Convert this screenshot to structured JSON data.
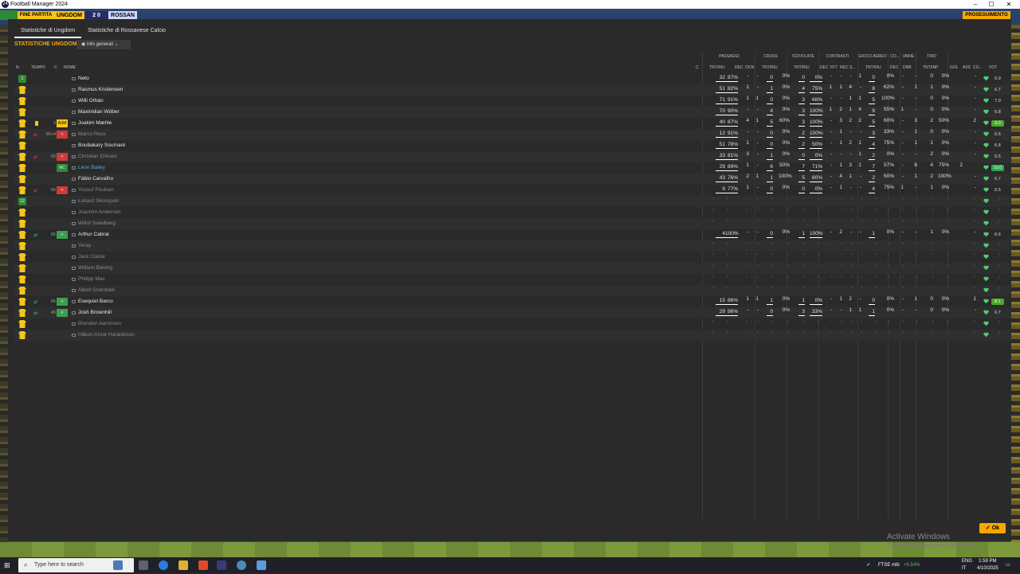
{
  "window": {
    "title": "Football Manager 2024",
    "app_icon": "24",
    "minimize": "–",
    "maximize": "☐",
    "close": "✕"
  },
  "scorebar": {
    "end_label": "FINE PARTITA",
    "home": "UNGDOM",
    "score": "2  0",
    "away": "ROSSAN",
    "continue": "PROSEGUIMENTO"
  },
  "tabs": [
    {
      "label": "Statistiche di Ungdom",
      "active": true
    },
    {
      "label": "Statistiche di Rossanese Calcio",
      "active": false
    }
  ],
  "section_title": "STATISTICHE UNGDOM",
  "view_select": {
    "label": "Info generali"
  },
  "groups": {
    "passaggi": "PASSAGGI",
    "cross": "CROSS",
    "scivolate": "SCIVOLATE",
    "contrasti": "CONTRASTI",
    "gioco_aereo": "GIOCO AEREO",
    "co": "CO...",
    "varie": "VARIE",
    "tiro": "TIRO"
  },
  "columns": {
    "n": "N.",
    "tempo": "TEMPO",
    "c": "C",
    "nome": "NOME",
    "c2": "C",
    "tnt_riu": "TNT/RIU",
    "dec": "DEC",
    "occ": "OCN",
    "cross_tnt": "TNT/RIU",
    "sciv_tnt": "TNT/RIU",
    "contr_dec": "DEC",
    "fft": "FFT",
    "rec": "REC S...",
    "aereo_tnt": "TNT/RIU",
    "co_dec": "DEC",
    "drb": "DRB",
    "tiro_tnt": "TNT/INP",
    "gol": "GOL",
    "ass": "ASS",
    "co2": "CO...",
    "vot": "VOT"
  },
  "players": [
    {
      "name": "Neto",
      "num": "1",
      "kit": "gk",
      "pass_t": "32",
      "pass_p": "87%",
      "dec": "-",
      "occ": "-",
      "cross_t": "0",
      "cross_p": "0%",
      "sciv_t": "0",
      "sciv_p": "0%",
      "c_dec": "-",
      "fft": "-",
      "rec": "-",
      "s": "1",
      "aer_t": "0",
      "aer_p": "0%",
      "co_dec": "-",
      "drb": "-",
      "tiro_t": "0",
      "tiro_p": "0%",
      "gol": "",
      "ass": "-",
      "rating": "6.9"
    },
    {
      "name": "Rasmus Kristensen",
      "pass_t": "51",
      "pass_p": "82%",
      "dec": "1",
      "occ": "-",
      "cross_t": "1",
      "cross_p": "0%",
      "sciv_t": "4",
      "sciv_p": "75%",
      "c_dec": "1",
      "fft": "1",
      "rec": "4",
      "s": "-",
      "aer_t": "8",
      "aer_p": "62%",
      "co_dec": "-",
      "drb": "1",
      "tiro_t": "1",
      "tiro_p": "0%",
      "gol": "",
      "ass": "-",
      "rating": "6.7"
    },
    {
      "name": "Willi Orbán",
      "pass_t": "71",
      "pass_p": "91%",
      "dec": "1",
      "occ": "1",
      "cross_t": "0",
      "cross_p": "0%",
      "sciv_t": "3",
      "sciv_p": "66%",
      "c_dec": "-",
      "fft": "-",
      "rec": "1",
      "s": "1",
      "aer_t": "5",
      "aer_p": "100%",
      "co_dec": "-",
      "drb": "-",
      "tiro_t": "0",
      "tiro_p": "0%",
      "gol": "",
      "ass": "-",
      "rating": "7.0"
    },
    {
      "name": "Maximilian Wöber",
      "pass_t": "70",
      "pass_p": "90%",
      "dec": "-",
      "occ": "-",
      "cross_t": "4",
      "cross_p": "0%",
      "sciv_t": "3",
      "sciv_p": "100%",
      "c_dec": "1",
      "fft": "2",
      "rec": "1",
      "s": "4",
      "aer_t": "9",
      "aer_p": "55%",
      "co_dec": "1",
      "drb": "-",
      "tiro_t": "0",
      "tiro_p": "0%",
      "gol": "",
      "ass": "-",
      "rating": "6.8"
    },
    {
      "name": "Joakim Mæhle",
      "time": "3",
      "pos": "ASM",
      "pos_color": "yellow",
      "card": true,
      "pass_t": "40",
      "pass_p": "87%",
      "dec": "4",
      "occ": "1",
      "cross_t": "5",
      "cross_p": "60%",
      "sciv_t": "3",
      "sciv_p": "100%",
      "c_dec": "-",
      "fft": "3",
      "rec": "2",
      "s": "2",
      "aer_t": "5",
      "aer_p": "60%",
      "co_dec": "-",
      "drb": "3",
      "tiro_t": "2",
      "tiro_p": "50%",
      "gol": "",
      "ass": "2",
      "rating": "9.0",
      "rating_style": "high"
    },
    {
      "name": "Marco Reus",
      "time": "90+4",
      "pos": "<",
      "pos_color": "red",
      "sub": "out",
      "dim": true,
      "pass_t": "12",
      "pass_p": "91%",
      "dec": "-",
      "occ": "-",
      "cross_t": "0",
      "cross_p": "0%",
      "sciv_t": "2",
      "sciv_p": "100%",
      "c_dec": "-",
      "fft": "1",
      "rec": "-",
      "s": "-",
      "aer_t": "3",
      "aer_p": "33%",
      "co_dec": "-",
      "drb": "1",
      "tiro_t": "0",
      "tiro_p": "0%",
      "gol": "",
      "ass": "-",
      "rating": "6.6"
    },
    {
      "name": "Boubakary Soumaré",
      "pass_t": "51",
      "pass_p": "78%",
      "dec": "1",
      "occ": "-",
      "cross_t": "0",
      "cross_p": "0%",
      "sciv_t": "2",
      "sciv_p": "50%",
      "c_dec": "-",
      "fft": "1",
      "rec": "2",
      "s": "1",
      "aer_t": "4",
      "aer_p": "75%",
      "co_dec": "-",
      "drb": "1",
      "tiro_t": "1",
      "tiro_p": "0%",
      "gol": "",
      "ass": "-",
      "rating": "6.8"
    },
    {
      "name": "Christian Eriksen",
      "time": "65",
      "pos": "<",
      "pos_color": "red",
      "sub": "out",
      "dim": true,
      "pass_t": "33",
      "pass_p": "81%",
      "dec": "3",
      "occ": "-",
      "cross_t": "1",
      "cross_p": "0%",
      "sciv_t": "0",
      "sciv_p": "0%",
      "c_dec": "-",
      "fft": "-",
      "rec": "-",
      "s": "1",
      "aer_t": "2",
      "aer_p": "0%",
      "co_dec": "-",
      "drb": "-",
      "tiro_t": "2",
      "tiro_p": "0%",
      "gol": "",
      "ass": "-",
      "rating": "6.5"
    },
    {
      "name": "Leon Bailey",
      "pos": "MC",
      "pos_color": "mc",
      "hl": true,
      "pass_t": "29",
      "pass_p": "89%",
      "dec": "1",
      "occ": "-",
      "cross_t": "6",
      "cross_p": "50%",
      "sciv_t": "7",
      "sciv_p": "71%",
      "c_dec": "-",
      "fft": "1",
      "rec": "3",
      "s": "1",
      "aer_t": "7",
      "aer_p": "57%",
      "co_dec": "-",
      "drb": "6",
      "tiro_t": "4",
      "tiro_p": "75%",
      "gol": "2",
      "ass": "",
      "rating": "10.0",
      "rating_style": "top"
    },
    {
      "name": "Fábio Carvalho",
      "pass_t": "43",
      "pass_p": "76%",
      "dec": "2",
      "occ": "1",
      "cross_t": "1",
      "cross_p": "100%",
      "sciv_t": "5",
      "sciv_p": "80%",
      "c_dec": "-",
      "fft": "4",
      "rec": "1",
      "s": "-",
      "aer_t": "2",
      "aer_p": "50%",
      "co_dec": "-",
      "drb": "1",
      "tiro_t": "2",
      "tiro_p": "100%",
      "gol": "",
      "ass": "-",
      "rating": "6.7"
    },
    {
      "name": "Yussuf Poulsen",
      "time": "65",
      "pos": "<",
      "pos_color": "red",
      "sub": "out",
      "dim": true,
      "pass_t": "9",
      "pass_p": "77%",
      "dec": "1",
      "occ": "-",
      "cross_t": "0",
      "cross_p": "0%",
      "sciv_t": "0",
      "sciv_p": "0%",
      "c_dec": "-",
      "fft": "1",
      "rec": "-",
      "s": "-",
      "aer_t": "4",
      "aer_p": "75%",
      "co_dec": "1",
      "drb": "-",
      "tiro_t": "1",
      "tiro_p": "0%",
      "gol": "",
      "ass": "-",
      "rating": "6.5"
    },
    {
      "name": "Łukasz Skorupski",
      "kit": "gk",
      "num": "12",
      "dim": true,
      "empty": true
    },
    {
      "name": "Joachim Andersen",
      "dim": true,
      "empty": true
    },
    {
      "name": "Willot Swedberg",
      "dim": true,
      "empty": true
    },
    {
      "name": "Arthur Cabral",
      "time": "65",
      "pos": ">",
      "pos_color": "green",
      "sub": "in",
      "pass_t": "4",
      "pass_p": "100%",
      "dec": "-",
      "occ": "-",
      "cross_t": "0",
      "cross_p": "0%",
      "sciv_t": "1",
      "sciv_p": "100%",
      "c_dec": "-",
      "fft": "2",
      "rec": "-",
      "s": "-",
      "aer_t": "1",
      "aer_p": "0%",
      "co_dec": "-",
      "drb": "-",
      "tiro_t": "1",
      "tiro_p": "0%",
      "gol": "",
      "ass": "-",
      "rating": "6.6"
    },
    {
      "name": "Yeray",
      "dim": true,
      "empty": true
    },
    {
      "name": "Jack Clarke",
      "dim": true,
      "empty": true
    },
    {
      "name": "William Bøving",
      "dim": true,
      "empty": true
    },
    {
      "name": "Philipp Max",
      "dim": true,
      "empty": true
    },
    {
      "name": "Albert Grønbæk",
      "dim": true,
      "empty": true
    },
    {
      "name": "Esequiel Barco",
      "time": "65",
      "pos": ">",
      "pos_color": "green",
      "sub": "in",
      "pass_t": "15",
      "pass_p": "86%",
      "dec": "1",
      "occ": "1",
      "cross_t": "1",
      "cross_p": "0%",
      "sciv_t": "1",
      "sciv_p": "0%",
      "c_dec": "-",
      "fft": "1",
      "rec": "2",
      "s": "-",
      "aer_t": "0",
      "aer_p": "0%",
      "co_dec": "-",
      "drb": "1",
      "tiro_t": "0",
      "tiro_p": "0%",
      "gol": "",
      "ass": "1",
      "rating": "8.1",
      "rating_style": "high"
    },
    {
      "name": "Josh Brownhill",
      "time": "45",
      "pos": ">",
      "pos_color": "green",
      "sub": "in",
      "pass_t": "29",
      "pass_p": "96%",
      "dec": "-",
      "occ": "-",
      "cross_t": "0",
      "cross_p": "0%",
      "sciv_t": "3",
      "sciv_p": "33%",
      "c_dec": "-",
      "fft": "-",
      "rec": "1",
      "s": "1",
      "aer_t": "1",
      "aer_p": "0%",
      "co_dec": "-",
      "drb": "-",
      "tiro_t": "0",
      "tiro_p": "0%",
      "gol": "",
      "ass": "-",
      "rating": "6.7"
    },
    {
      "name": "Brenden Aaronson",
      "dim": true,
      "empty": true
    },
    {
      "name": "Håkon Arnar Haraldsson",
      "dim": true,
      "empty": true
    }
  ],
  "watermark": {
    "line1": "Activate Windows",
    "line2": "Go to Settings to activate Windows."
  },
  "ok_button": "Ok",
  "taskbar": {
    "search_placeholder": "Type here to search",
    "ticker": "FTSE mib",
    "ticker_change": "+6.54%",
    "lang": "ENG",
    "region": "IT",
    "time": "1:59 PM",
    "date": "4/10/2025"
  },
  "colors": {
    "accent": "#f5a800",
    "kit": "#f5c518",
    "good": "#4aa82a"
  }
}
